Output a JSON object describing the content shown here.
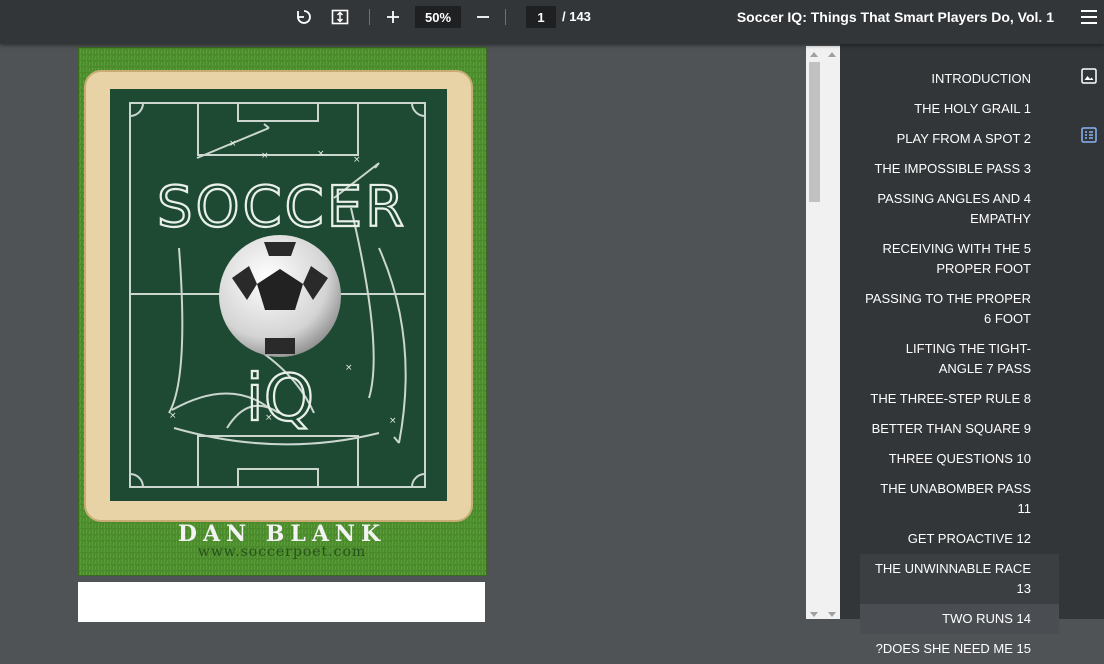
{
  "toolbar": {
    "zoom": "50%",
    "current_page": "1",
    "page_total": "/ 143",
    "title": "Soccer IQ: Things That Smart Players Do, Vol. 1",
    "icons": [
      "rotate-icon",
      "fit-page-icon",
      "zoom-in-icon",
      "zoom-out-icon",
      "menu-icon"
    ]
  },
  "cover": {
    "title_word1": "SOCCER",
    "title_word2": "iQ",
    "author": "DAN BLANK",
    "website": "www.soccerpoet.com",
    "colors": {
      "grass": "#4d8a2e",
      "frame": "#e8d6ac",
      "board": "#1f4a35",
      "chalk": "#e9efe9"
    }
  },
  "outline": {
    "items": [
      "INTRODUCTION",
      "THE HOLY GRAIL 1",
      "PLAY FROM A SPOT 2",
      "THE IMPOSSIBLE PASS 3",
      "PASSING ANGLES AND 4 EMPATHY",
      "RECEIVING WITH THE 5 PROPER FOOT",
      "PASSING TO THE PROPER 6 FOOT",
      "LIFTING THE TIGHT-ANGLE 7 PASS",
      "THE THREE-STEP RULE 8",
      "BETTER THAN SQUARE 9",
      "THREE QUESTIONS 10",
      "THE UNABOMBER PASS 11",
      "GET PROACTIVE 12",
      "THE UNWINNABLE RACE 13",
      "TWO RUNS 14",
      "?DOES SHE NEED ME 15"
    ],
    "hover_index": 13,
    "active_index": 14
  },
  "rail": {
    "icons": [
      "thumbnails-icon",
      "outline-icon"
    ],
    "active_color": "#8ab4f8"
  }
}
